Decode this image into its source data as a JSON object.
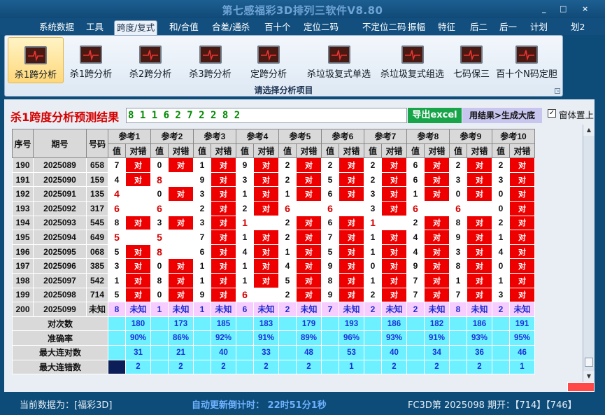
{
  "window": {
    "title": "第七感福彩3D排列三软件V8.80",
    "controls": [
      "_",
      "□",
      "×"
    ]
  },
  "menu": [
    "系统数据",
    "工具",
    "跨度/复式",
    "和/合值",
    "合差/通杀",
    "百十个",
    "定位二码",
    "不定位二码",
    "振幅",
    "特征",
    "后二",
    "后一",
    "计划",
    "划2"
  ],
  "menu_active": 2,
  "ribbon": {
    "buttons": [
      "杀1跨分析",
      "杀1跨分析",
      "杀2跨分析",
      "杀3跨分析",
      "定跨分析",
      "杀垃圾复式单选",
      "杀垃圾复式组选",
      "七码保三",
      "百十个N码定胆"
    ],
    "caption": "请选择分析项目"
  },
  "result": {
    "title": "杀1跨度分析预测结果",
    "value": "8 1 1 6 2 7 2 2 8 2",
    "excel_btn": "导出excel",
    "gen_btn": "用结果>生成大底",
    "topmost_label": "窗体置上",
    "topmost_checked": true
  },
  "table": {
    "h_seq": "序号",
    "h_period": "期号",
    "h_code": "号码",
    "refs": [
      "参考1",
      "参考2",
      "参考3",
      "参考4",
      "参考5",
      "参考6",
      "参考7",
      "参考8",
      "参考9",
      "参考10"
    ],
    "sub": [
      "值",
      "对错"
    ],
    "rows": [
      {
        "seq": "190",
        "period": "2025089",
        "code": "658",
        "vals": [
          "7",
          "0",
          "1",
          "9",
          "2",
          "2",
          "2",
          "6",
          "2",
          "2"
        ],
        "hit": [
          1,
          1,
          1,
          1,
          1,
          1,
          1,
          1,
          1,
          1
        ]
      },
      {
        "seq": "191",
        "period": "2025090",
        "code": "159",
        "vals": [
          "4",
          "8",
          "9",
          "3",
          "2",
          "5",
          "2",
          "6",
          "3",
          "3"
        ],
        "hit": [
          1,
          0,
          1,
          1,
          1,
          1,
          1,
          1,
          1,
          1
        ]
      },
      {
        "seq": "192",
        "period": "2025091",
        "code": "135",
        "vals": [
          "4",
          "0",
          "3",
          "1",
          "1",
          "6",
          "3",
          "1",
          "0",
          "0"
        ],
        "hit": [
          0,
          1,
          1,
          1,
          1,
          1,
          1,
          1,
          1,
          1
        ]
      },
      {
        "seq": "193",
        "period": "2025092",
        "code": "317",
        "vals": [
          "6",
          "6",
          "2",
          "2",
          "6",
          "6",
          "3",
          "6",
          "6",
          "0"
        ],
        "hit": [
          0,
          0,
          1,
          1,
          0,
          0,
          1,
          0,
          0,
          1
        ]
      },
      {
        "seq": "194",
        "period": "2025093",
        "code": "545",
        "vals": [
          "8",
          "3",
          "3",
          "1",
          "2",
          "6",
          "1",
          "2",
          "8",
          "2"
        ],
        "hit": [
          1,
          1,
          1,
          0,
          1,
          1,
          0,
          1,
          1,
          1
        ]
      },
      {
        "seq": "195",
        "period": "2025094",
        "code": "649",
        "vals": [
          "5",
          "5",
          "7",
          "1",
          "2",
          "7",
          "1",
          "4",
          "9",
          "1"
        ],
        "hit": [
          0,
          0,
          1,
          1,
          1,
          1,
          1,
          1,
          1,
          1
        ]
      },
      {
        "seq": "196",
        "period": "2025095",
        "code": "068",
        "vals": [
          "5",
          "8",
          "6",
          "4",
          "1",
          "5",
          "1",
          "4",
          "3",
          "4"
        ],
        "hit": [
          1,
          0,
          1,
          1,
          1,
          1,
          1,
          1,
          1,
          1
        ]
      },
      {
        "seq": "197",
        "period": "2025096",
        "code": "385",
        "vals": [
          "3",
          "0",
          "1",
          "1",
          "4",
          "9",
          "0",
          "9",
          "8",
          "0"
        ],
        "hit": [
          1,
          1,
          1,
          1,
          1,
          1,
          1,
          1,
          1,
          1
        ]
      },
      {
        "seq": "198",
        "period": "2025097",
        "code": "542",
        "vals": [
          "1",
          "8",
          "1",
          "1",
          "5",
          "8",
          "1",
          "7",
          "1",
          "1"
        ],
        "hit": [
          1,
          1,
          1,
          1,
          1,
          1,
          1,
          1,
          1,
          1
        ]
      },
      {
        "seq": "199",
        "period": "2025098",
        "code": "714",
        "vals": [
          "5",
          "0",
          "9",
          "6",
          "2",
          "9",
          "2",
          "7",
          "7",
          "3"
        ],
        "hit": [
          1,
          1,
          1,
          0,
          1,
          1,
          1,
          1,
          1,
          1
        ]
      },
      {
        "seq": "200",
        "period": "2025099",
        "code": "未知",
        "vals": [
          "8",
          "1",
          "1",
          "6",
          "2",
          "7",
          "2",
          "2",
          "8",
          "2"
        ],
        "unknown": "未知"
      }
    ],
    "stats": [
      {
        "label": "对次数",
        "values": [
          "180",
          "173",
          "185",
          "183",
          "179",
          "193",
          "186",
          "182",
          "186",
          "191"
        ]
      },
      {
        "label": "准确率",
        "values": [
          "90%",
          "86%",
          "92%",
          "91%",
          "89%",
          "96%",
          "93%",
          "91%",
          "93%",
          "95%"
        ]
      },
      {
        "label": "最大连对数",
        "values": [
          "31",
          "21",
          "40",
          "33",
          "48",
          "53",
          "40",
          "34",
          "36",
          "46"
        ]
      },
      {
        "label": "最大连错数",
        "values": [
          "2",
          "2",
          "2",
          "2",
          "2",
          "1",
          "2",
          "2",
          "2",
          "1"
        ]
      }
    ],
    "hit_mark": "对"
  },
  "status": {
    "current": "当前数据为：[福彩3D]",
    "countdown": "自动更新倒计时：  22时51分1秒",
    "latest": "FC3D第 2025098 期开：【714】【746】"
  }
}
